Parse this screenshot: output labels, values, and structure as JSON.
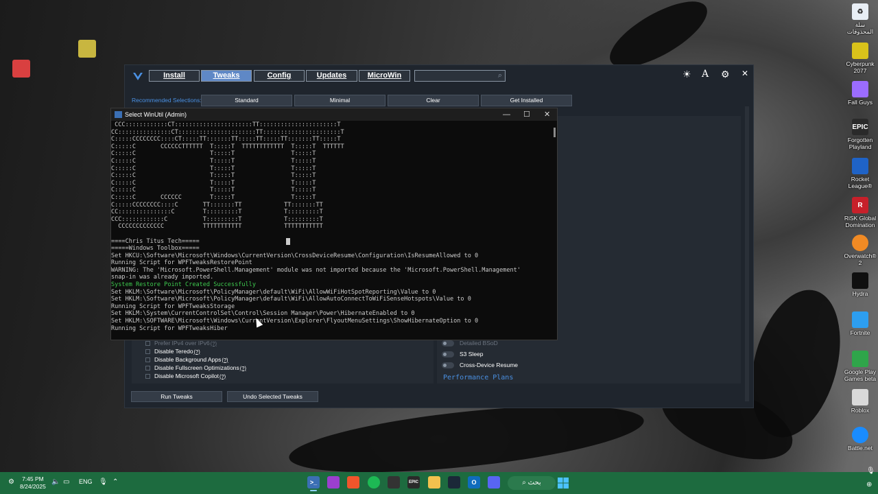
{
  "desktop": {
    "right_icons": [
      {
        "label": "سلة المحذوفات",
        "icon": "recycle-bin-icon",
        "color": "#e8eef5"
      },
      {
        "label": "Cyberpunk 2077",
        "icon": "cyberpunk-icon",
        "color": "#d9c21a"
      },
      {
        "label": "Fall Guys",
        "icon": "fall-guys-icon",
        "color": "#9b6cff"
      },
      {
        "label": "Forgotten Playland",
        "icon": "epic-games-icon",
        "color": "#2a2a2a"
      },
      {
        "label": "Rocket League®",
        "icon": "rocket-league-icon",
        "color": "#1f63c7"
      },
      {
        "label": "RiSK Global Domination",
        "icon": "risk-icon",
        "color": "#c7202a"
      },
      {
        "label": "Overwatch® 2",
        "icon": "overwatch-icon",
        "color": "#f08a24"
      },
      {
        "label": "Hydra",
        "icon": "hydra-icon",
        "color": "#101010"
      },
      {
        "label": "Fortnite",
        "icon": "fortnite-icon",
        "color": "#2d9ef0"
      },
      {
        "label": "Google Play Games beta",
        "icon": "google-play-games-icon",
        "color": "#2fa54a"
      },
      {
        "label": "Roblox",
        "icon": "roblox-icon",
        "color": "#d9d9d9"
      },
      {
        "label": "Battle.net",
        "icon": "battle-net-icon",
        "color": "#1a8cff"
      }
    ]
  },
  "winutil": {
    "tabs": [
      "Install",
      "Tweaks",
      "Config",
      "Updates",
      "MicroWin"
    ],
    "active_tab": "Tweaks",
    "search_placeholder": "",
    "recommended_label": "Recommended Selections:",
    "recommended_buttons": [
      "Standard",
      "Minimal",
      "Clear",
      "Get Installed"
    ],
    "left_items": [
      {
        "label": "Prefer IPv4 over IPv6",
        "dim": true
      },
      {
        "label": "Disable Teredo",
        "dim": false
      },
      {
        "label": "Disable Background Apps",
        "dim": false
      },
      {
        "label": "Disable Fullscreen Optimizations",
        "dim": false
      },
      {
        "label": "Disable Microsoft Copilot",
        "dim": false
      }
    ],
    "help_mark": "(?)",
    "right_items": [
      {
        "label": "Detailed BSoD",
        "dim": true
      },
      {
        "label": "S3 Sleep",
        "dim": false
      },
      {
        "label": "Cross-Device Resume",
        "dim": false
      }
    ],
    "performance_plans": "Performance Plans",
    "run_tweaks": "Run Tweaks",
    "undo_tweaks": "Undo Selected Tweaks",
    "accent": "#5f88c6"
  },
  "console": {
    "title": "Select WinUtil (Admin)",
    "lines": [
      {
        "text": " CCC::::::::::::CT::::::::::::::::::::::TT::::::::::::::::::::::T",
        "green": false
      },
      {
        "text": "CC:::::::::::::::CT::::::::::::::::::::::TT::::::::::::::::::::::T",
        "green": false
      },
      {
        "text": "C:::::CCCCCCCC::::CT:::::TT:::::::TT:::::TT:::::TT:::::::TT:::::T",
        "green": false
      },
      {
        "text": "C:::::C       CCCCCCTTTTTT  T:::::T  TTTTTTTTTTTT  T:::::T  TTTTTT",
        "green": false
      },
      {
        "text": "C:::::C                     T:::::T                T:::::T",
        "green": false
      },
      {
        "text": "C:::::C                     T:::::T                T:::::T",
        "green": false
      },
      {
        "text": "C:::::C                     T:::::T                T:::::T",
        "green": false
      },
      {
        "text": "C:::::C                     T:::::T                T:::::T",
        "green": false
      },
      {
        "text": "C:::::C                     T:::::T                T:::::T",
        "green": false
      },
      {
        "text": "C:::::C                     T:::::T                T:::::T",
        "green": false
      },
      {
        "text": "C:::::C       CCCCCC        T:::::T                T:::::T",
        "green": false
      },
      {
        "text": "C:::::CCCCCCCC::::C       TT:::::::TT            TT:::::::TT",
        "green": false
      },
      {
        "text": "CC:::::::::::::::C        T:::::::::T            T:::::::::T",
        "green": false
      },
      {
        "text": "CCC::::::::::::C          T:::::::::T            T:::::::::T",
        "green": false
      },
      {
        "text": "  CCCCCCCCCCCCC           TTTTTTTTTTT            TTTTTTTTTTT",
        "green": false
      },
      {
        "text": "",
        "green": false
      },
      {
        "text": "====Chris Titus Tech=====",
        "green": false
      },
      {
        "text": "=====Windows Toolbox=====",
        "green": false
      },
      {
        "text": "Set HKCU:\\Software\\Microsoft\\Windows\\CurrentVersion\\CrossDeviceResume\\Configuration\\IsResumeAllowed to 0",
        "green": false
      },
      {
        "text": "Running Script for WPFTweaksRestorePoint",
        "green": false
      },
      {
        "text": "WARNING: The 'Microsoft.PowerShell.Management' module was not imported because the 'Microsoft.PowerShell.Management'",
        "green": false
      },
      {
        "text": "snap-in was already imported.",
        "green": false
      },
      {
        "text": "System Restore Point Created Successfully",
        "green": true
      },
      {
        "text": "Set HKLM:\\Software\\Microsoft\\PolicyManager\\default\\WiFi\\AllowWiFiHotSpotReporting\\Value to 0",
        "green": false
      },
      {
        "text": "Set HKLM:\\Software\\Microsoft\\PolicyManager\\default\\WiFi\\AllowAutoConnectToWiFiSenseHotspots\\Value to 0",
        "green": false
      },
      {
        "text": "Running Script for WPFTweaksStorage",
        "green": false
      },
      {
        "text": "Set HKLM:\\System\\CurrentControlSet\\Control\\Session Manager\\Power\\HibernateEnabled to 0",
        "green": false
      },
      {
        "text": "Set HKLM:\\SOFTWARE\\Microsoft\\Windows\\CurrentVersion\\Explorer\\FlyoutMenuSettings\\ShowHibernateOption to 0",
        "green": false
      },
      {
        "text": "Running Script for WPFTweaksHiber",
        "green": false
      }
    ]
  },
  "taskbar": {
    "time": "7:45 PM",
    "date": "8/24/2025",
    "language": "ENG",
    "search_label": "بحث",
    "color": "#1d6b3f",
    "apps": [
      {
        "icon": "terminal-icon",
        "color": "#3b6fb4",
        "active": true
      },
      {
        "icon": "app-purple-icon",
        "color": "#9b3fcf",
        "active": false
      },
      {
        "icon": "brave-icon",
        "color": "#f1552b",
        "active": false
      },
      {
        "icon": "spotify-icon",
        "color": "#1db954",
        "active": false
      },
      {
        "icon": "unity-icon",
        "color": "#333333",
        "active": false
      },
      {
        "icon": "epic-games-icon",
        "color": "#2a2a2a",
        "active": false
      },
      {
        "icon": "file-explorer-icon",
        "color": "#f2c14e",
        "active": false
      },
      {
        "icon": "steam-icon",
        "color": "#1b2838",
        "active": false
      },
      {
        "icon": "outlook-icon",
        "color": "#0f6cbd",
        "active": false
      },
      {
        "icon": "discord-icon",
        "color": "#5865f2",
        "active": false
      }
    ]
  }
}
